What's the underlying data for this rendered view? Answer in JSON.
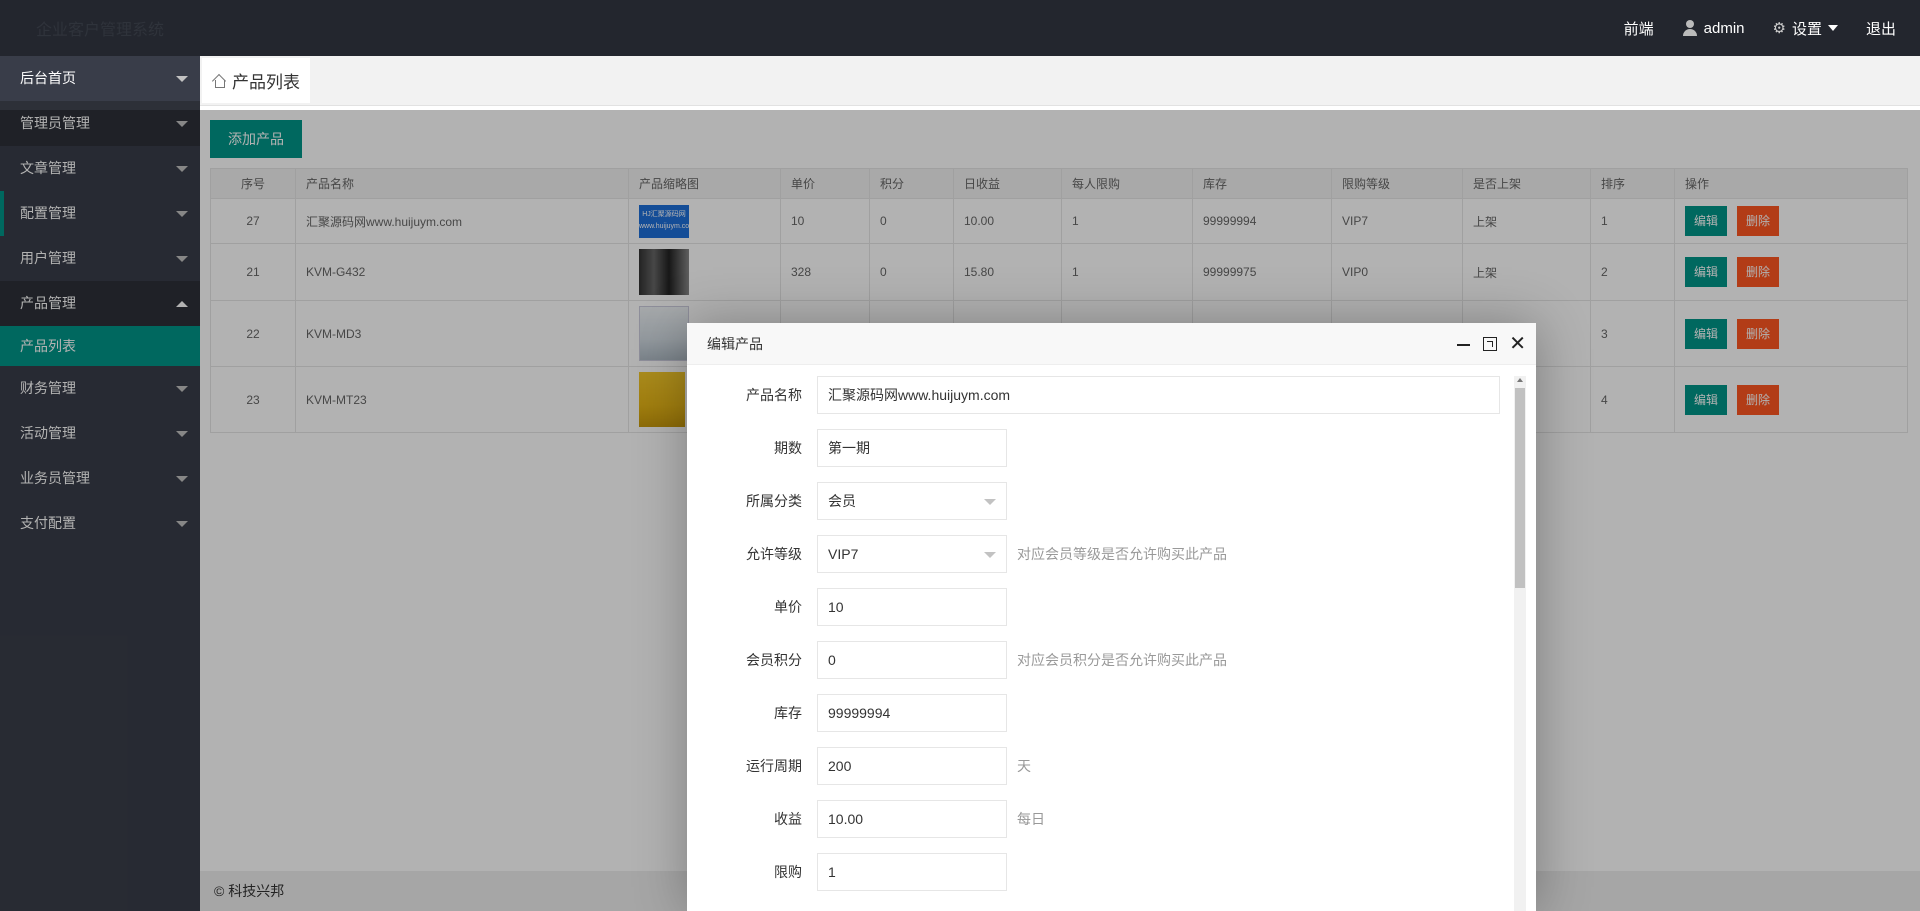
{
  "header": {
    "logo": "企业客户管理系统",
    "nav": [
      {
        "label": "前端"
      },
      {
        "label": "admin"
      },
      {
        "label": "设置"
      },
      {
        "label": "退出"
      }
    ]
  },
  "sidebar": {
    "items": [
      {
        "label": "后台首页"
      },
      {
        "label": "管理员管理"
      },
      {
        "label": "文章管理"
      },
      {
        "label": "配置管理"
      },
      {
        "label": "用户管理"
      },
      {
        "label": "产品管理"
      },
      {
        "label": "产品列表"
      },
      {
        "label": "财务管理"
      },
      {
        "label": "活动管理"
      },
      {
        "label": "业务员管理"
      },
      {
        "label": "支付配置"
      }
    ]
  },
  "tab": {
    "label": "产品列表"
  },
  "toolbar": {
    "add_label": "添加产品"
  },
  "table": {
    "headers": [
      "序号",
      "产品名称",
      "产品缩略图",
      "单价",
      "积分",
      "日收益",
      "每人限购",
      "库存",
      "限购等级",
      "是否上架",
      "排序",
      "操作"
    ],
    "rows": [
      {
        "id": "27",
        "name": "汇聚源码网www.huijuym.com",
        "thumb_text": "HJ汇聚源码网 www.huijuym.com",
        "price": "10",
        "points": "0",
        "daily": "10.00",
        "limit": "1",
        "stock": "99999994",
        "level": "VIP7",
        "listed": "上架",
        "sort": "1"
      },
      {
        "id": "21",
        "name": "KVM-G432",
        "price": "328",
        "points": "0",
        "daily": "15.80",
        "limit": "1",
        "stock": "99999975",
        "level": "VIP0",
        "listed": "上架",
        "sort": "2"
      },
      {
        "id": "22",
        "name": "KVM-MD3",
        "price": "",
        "points": "",
        "daily": "",
        "limit": "",
        "stock": "",
        "level": "",
        "listed": "",
        "sort": "3"
      },
      {
        "id": "23",
        "name": "KVM-MT23",
        "price": "",
        "points": "",
        "daily": "",
        "limit": "",
        "stock": "",
        "level": "",
        "listed": "",
        "sort": "4"
      }
    ],
    "edit_label": "编辑",
    "delete_label": "删除"
  },
  "footer": {
    "text": "© 科技兴邦"
  },
  "modal": {
    "title": "编辑产品",
    "fields": [
      {
        "label": "产品名称",
        "value": "汇聚源码网www.huijuym.com",
        "hint": ""
      },
      {
        "label": "期数",
        "value": "第一期",
        "hint": ""
      },
      {
        "label": "所属分类",
        "value": "会员",
        "hint": ""
      },
      {
        "label": "允许等级",
        "value": "VIP7",
        "hint": "对应会员等级是否允许购买此产品"
      },
      {
        "label": "单价",
        "value": "10",
        "hint": ""
      },
      {
        "label": "会员积分",
        "value": "0",
        "hint": "对应会员积分是否允许购买此产品"
      },
      {
        "label": "库存",
        "value": "99999994",
        "hint": ""
      },
      {
        "label": "运行周期",
        "value": "200",
        "hint": "天"
      },
      {
        "label": "收益",
        "value": "10.00",
        "hint": "每日"
      },
      {
        "label": "限购",
        "value": "1",
        "hint": ""
      }
    ]
  }
}
